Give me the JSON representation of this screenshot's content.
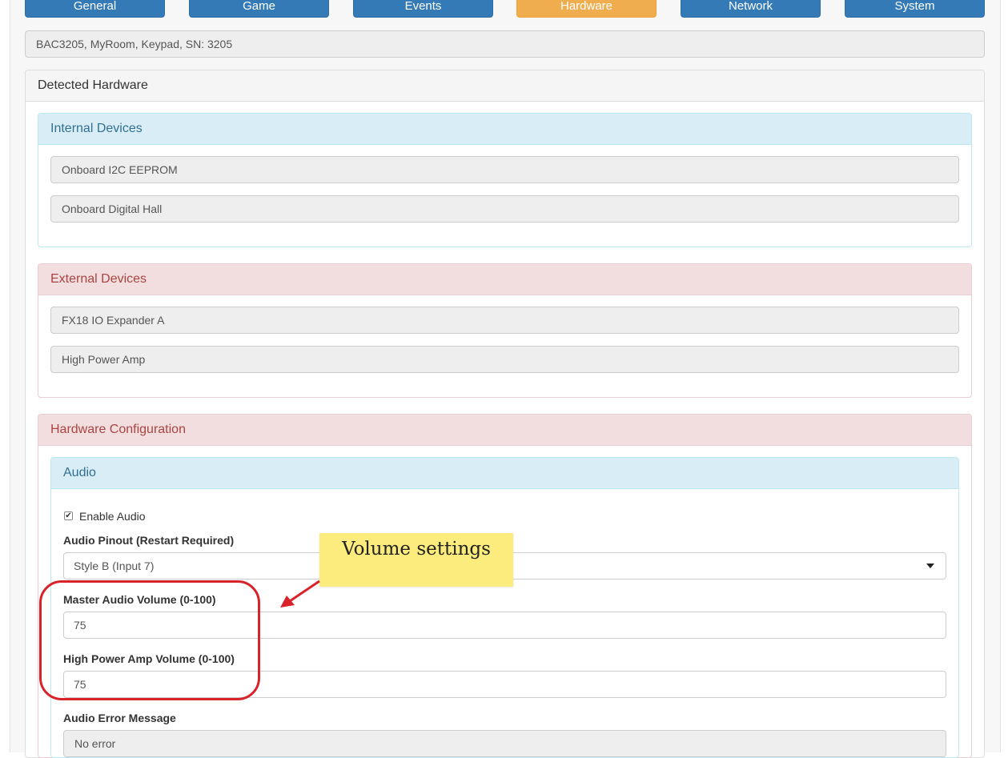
{
  "nav": {
    "general": "General",
    "game": "Game",
    "events": "Events",
    "hardware": "Hardware",
    "network": "Network",
    "system": "System"
  },
  "device_summary": "BAC3205, MyRoom, Keypad, SN: 3205",
  "detected_hardware": {
    "title": "Detected Hardware",
    "internal": {
      "title": "Internal Devices",
      "items": [
        "Onboard I2C EEPROM",
        "Onboard Digital Hall"
      ]
    },
    "external": {
      "title": "External Devices",
      "items": [
        "FX18 IO Expander A",
        "High Power Amp"
      ]
    },
    "config": {
      "title": "Hardware Configuration",
      "audio": {
        "title": "Audio",
        "enable_label": "Enable Audio",
        "enable_checked": true,
        "pinout_label": "Audio Pinout (Restart Required)",
        "pinout_value": "Style B (Input 7)",
        "master_label": "Master Audio Volume (0-100)",
        "master_value": "75",
        "amp_label": "High Power Amp Volume (0-100)",
        "amp_value": "75",
        "error_label": "Audio Error Message",
        "error_value": "No error"
      }
    }
  },
  "annotation": {
    "callout_text": "Volume settings",
    "color": "#d9232a",
    "callout_bg": "#fbec7d"
  },
  "colors": {
    "primary": "#337ab7",
    "warning": "#f0ad4e",
    "info_head": "#d9edf7",
    "danger_head": "#f2dede"
  }
}
